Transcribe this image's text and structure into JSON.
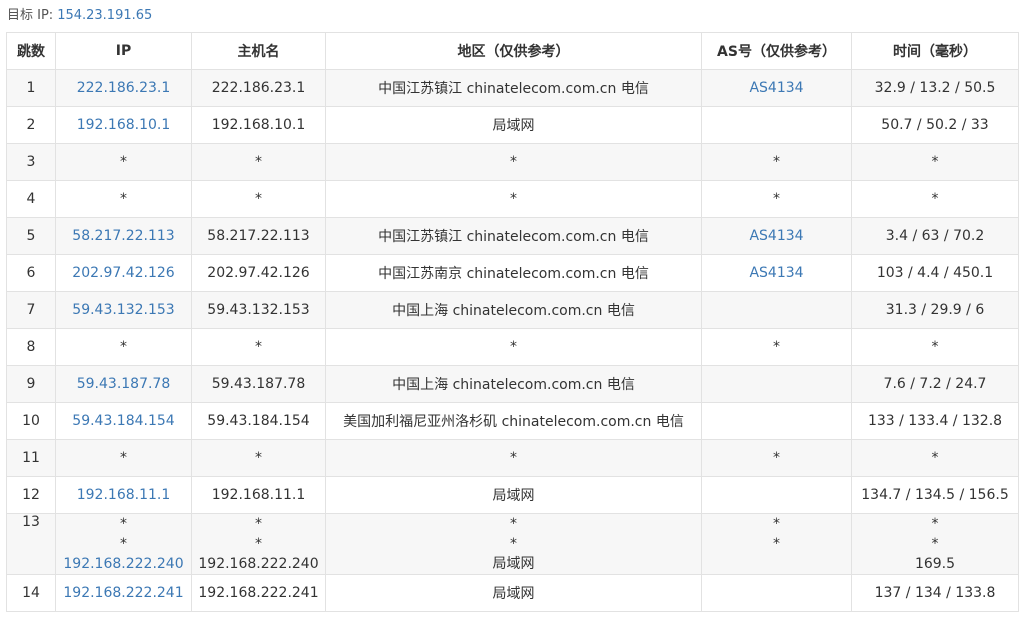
{
  "target": {
    "label": "目标 IP:",
    "ip": "154.23.191.65"
  },
  "columns": [
    "跳数",
    "IP",
    "主机名",
    "地区（仅供参考）",
    "AS号（仅供参考）",
    "时间（毫秒）"
  ],
  "rows": [
    {
      "hop": "1",
      "ip": "222.186.23.1",
      "host": "222.186.23.1",
      "region": "中国江苏镇江 chinatelecom.com.cn 电信",
      "asn": "AS4134",
      "time": "32.9 / 13.2 / 50.5"
    },
    {
      "hop": "2",
      "ip": "192.168.10.1",
      "host": "192.168.10.1",
      "region": "局域网",
      "asn": "",
      "time": "50.7 / 50.2 / 33"
    },
    {
      "hop": "3",
      "ip": "*",
      "host": "*",
      "region": "*",
      "asn": "*",
      "time": "*"
    },
    {
      "hop": "4",
      "ip": "*",
      "host": "*",
      "region": "*",
      "asn": "*",
      "time": "*"
    },
    {
      "hop": "5",
      "ip": "58.217.22.113",
      "host": "58.217.22.113",
      "region": "中国江苏镇江 chinatelecom.com.cn 电信",
      "asn": "AS4134",
      "time": "3.4 / 63 / 70.2"
    },
    {
      "hop": "6",
      "ip": "202.97.42.126",
      "host": "202.97.42.126",
      "region": "中国江苏南京 chinatelecom.com.cn 电信",
      "asn": "AS4134",
      "time": "103 / 4.4 / 450.1"
    },
    {
      "hop": "7",
      "ip": "59.43.132.153",
      "host": "59.43.132.153",
      "region": "中国上海 chinatelecom.com.cn 电信",
      "asn": "",
      "time": "31.3 / 29.9 / 6"
    },
    {
      "hop": "8",
      "ip": "*",
      "host": "*",
      "region": "*",
      "asn": "*",
      "time": "*"
    },
    {
      "hop": "9",
      "ip": "59.43.187.78",
      "host": "59.43.187.78",
      "region": "中国上海 chinatelecom.com.cn 电信",
      "asn": "",
      "time": "7.6 / 7.2 / 24.7"
    },
    {
      "hop": "10",
      "ip": "59.43.184.154",
      "host": "59.43.184.154",
      "region": "美国加利福尼亚州洛杉矶 chinatelecom.com.cn 电信",
      "asn": "",
      "time": "133 / 133.4 / 132.8"
    },
    {
      "hop": "11",
      "ip": "*",
      "host": "*",
      "region": "*",
      "asn": "*",
      "time": "*"
    },
    {
      "hop": "12",
      "ip": "192.168.11.1",
      "host": "192.168.11.1",
      "region": "局域网",
      "asn": "",
      "time": "134.7 / 134.5 / 156.5"
    },
    {
      "hop": "13",
      "ip_lines": [
        "*",
        "*",
        "192.168.222.240"
      ],
      "host_lines": [
        "*",
        "*",
        "192.168.222.240"
      ],
      "region_lines": [
        "*",
        "*",
        "局域网"
      ],
      "asn_lines": [
        "*",
        "*",
        ""
      ],
      "time_lines": [
        "*",
        "*",
        "169.5"
      ]
    },
    {
      "hop": "14",
      "ip": "192.168.222.241",
      "host": "192.168.222.241",
      "region": "局域网",
      "asn": "",
      "time": "137 / 134 / 133.8"
    }
  ]
}
